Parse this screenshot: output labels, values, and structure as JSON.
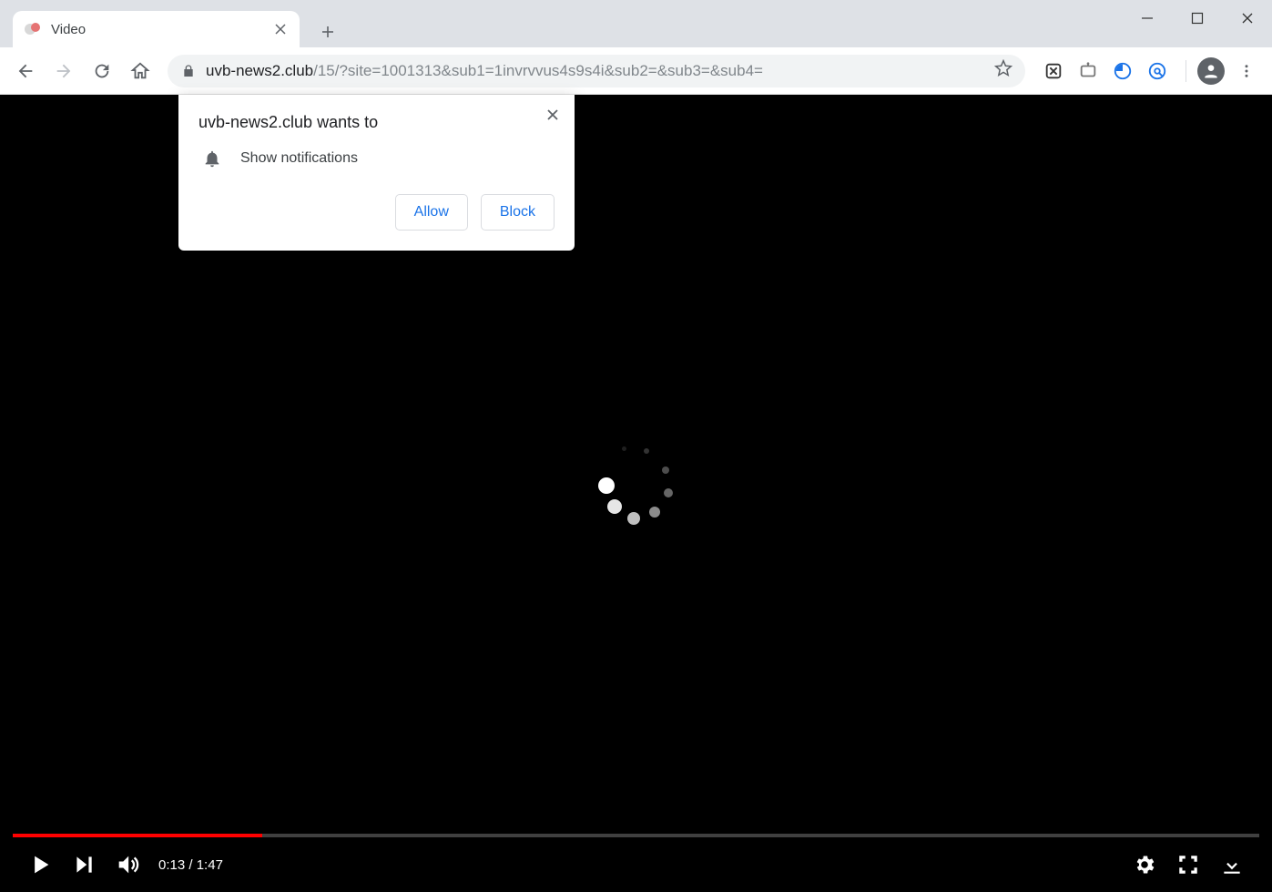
{
  "tab": {
    "title": "Video"
  },
  "url": {
    "host": "uvb-news2.club",
    "path": "/15/?site=1001313&sub1=1invrvvus4s9s4i&sub2=&sub3=&sub4="
  },
  "popup": {
    "heading": "uvb-news2.club wants to",
    "permission": "Show notifications",
    "allow": "Allow",
    "block": "Block"
  },
  "video": {
    "current": "0:13",
    "sep": " / ",
    "total": "1:47",
    "progress_percent": 20
  }
}
